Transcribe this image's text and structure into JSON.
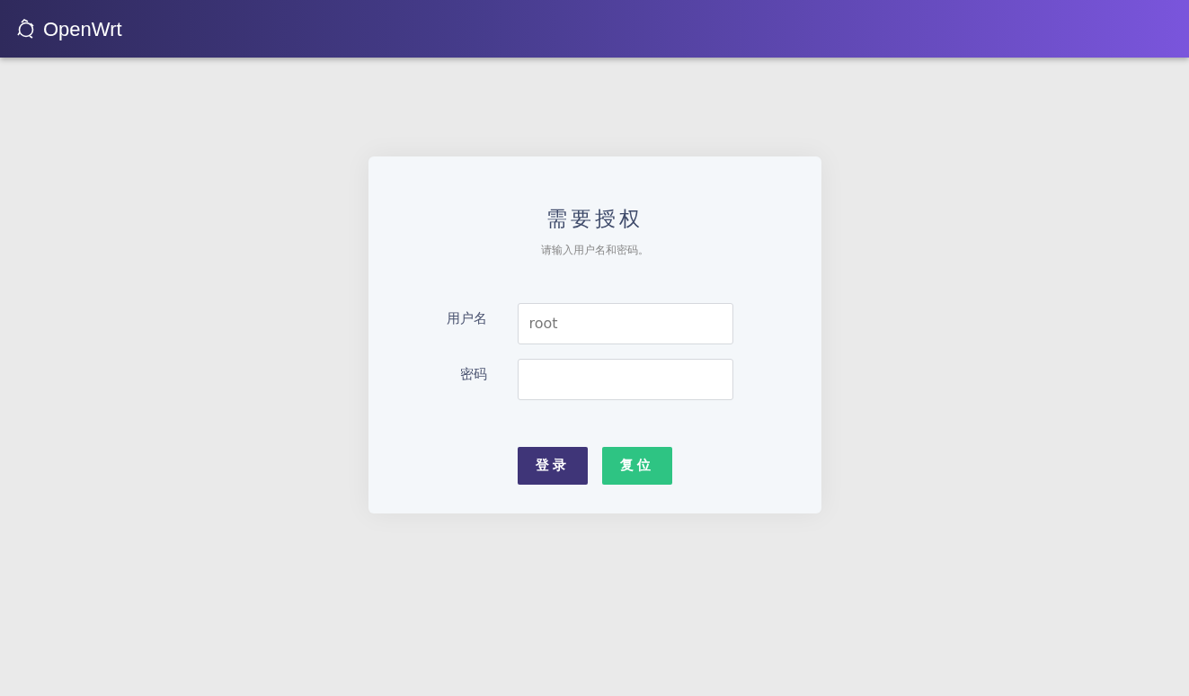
{
  "header": {
    "brand": "OpenWrt"
  },
  "login": {
    "title": "需要授权",
    "subtitle": "请输入用户名和密码。",
    "fields": [
      {
        "label": "用户名",
        "value": "root",
        "kind": "text"
      },
      {
        "label": "密码",
        "kind": "password"
      }
    ],
    "buttons": [
      {
        "label": "登录",
        "kind": "primary"
      },
      {
        "label": "复位",
        "kind": "reset"
      }
    ]
  }
}
